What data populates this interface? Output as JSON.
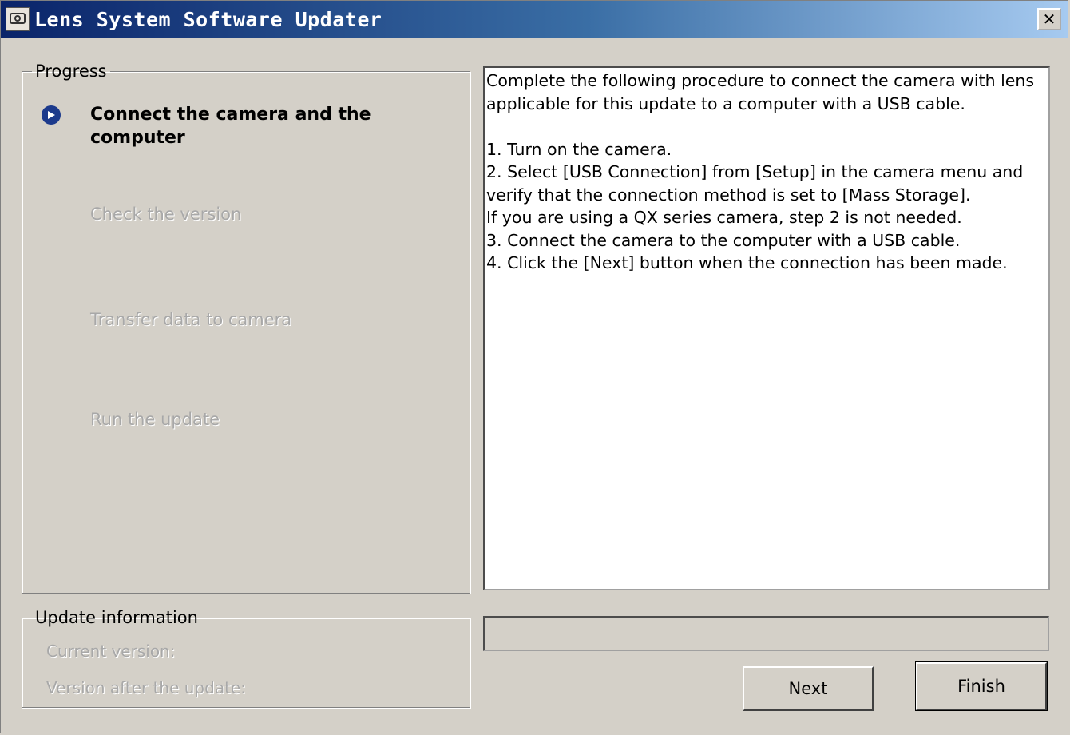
{
  "window": {
    "title": "Lens System Software Updater",
    "close_label": "✕"
  },
  "progress": {
    "legend": "Progress",
    "steps": [
      {
        "label": "Connect the camera and the computer",
        "state": "current"
      },
      {
        "label": "Check the version",
        "state": "pending"
      },
      {
        "label": "Transfer data to camera",
        "state": "pending"
      },
      {
        "label": "Run the update",
        "state": "pending"
      }
    ]
  },
  "update_info": {
    "legend": "Update information",
    "current_version_label": "Current version:",
    "version_after_label": "Version after the update:"
  },
  "instructions": "Complete the following procedure to connect the camera with lens applicable for this update to a computer with a USB cable.\n\n1. Turn on the camera.\n2. Select [USB Connection] from [Setup] in the camera menu and verify that the connection method is set to [Mass Storage].\nIf you are using a QX series camera, step 2 is not needed.\n3. Connect the camera to the computer with a USB cable.\n4. Click the [Next] button when the connection has been made.",
  "progress_bar": {
    "value": 0
  },
  "buttons": {
    "next": "Next",
    "finish": "Finish"
  },
  "colors": {
    "titlebar_start": "#0a246a",
    "active_step_icon": "#1c3a8c",
    "disabled_text": "#a8a8a8"
  },
  "icons": {
    "app": "lens-updater-app-icon",
    "current_step": "play-circle-icon",
    "close": "close-icon"
  }
}
